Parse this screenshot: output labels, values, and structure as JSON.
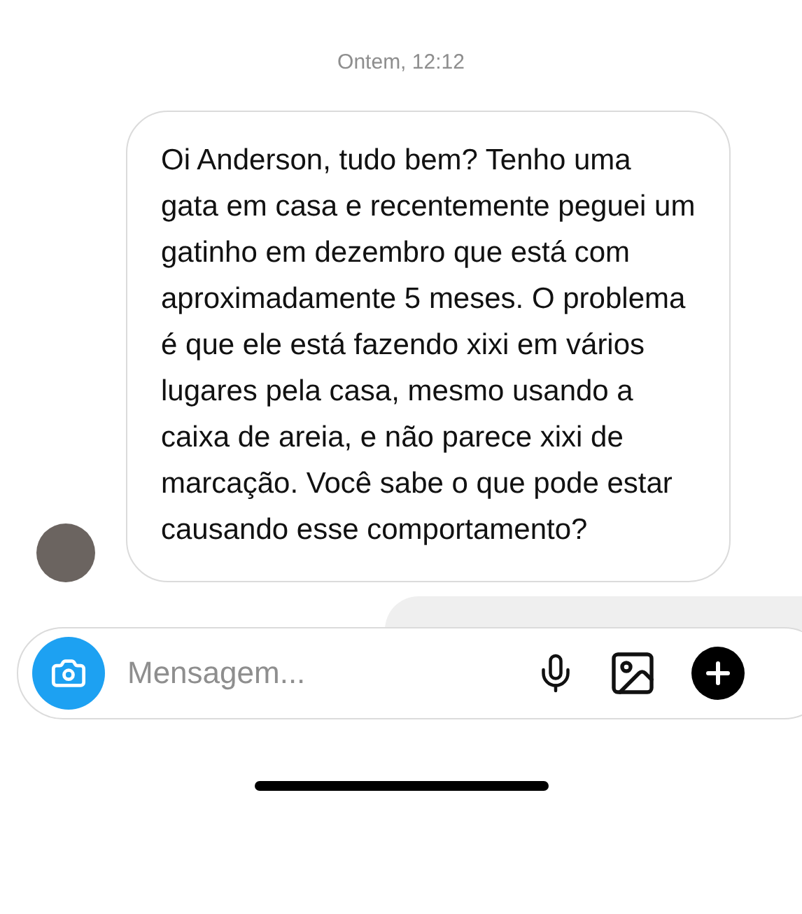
{
  "timestamp": "Ontem, 12:12",
  "message": {
    "text": "Oi Anderson, tudo bem? Tenho uma gata em casa e recentemente peguei um gatinho em dezembro que está com aproximadamente 5 meses. O problema é que ele está fazendo xixi em vários lugares pela casa, mesmo usando a caixa de areia, e não parece xixi de marcação. Você sabe o que pode estar causando esse comportamento?"
  },
  "composer": {
    "placeholder": "Mensagem..."
  }
}
